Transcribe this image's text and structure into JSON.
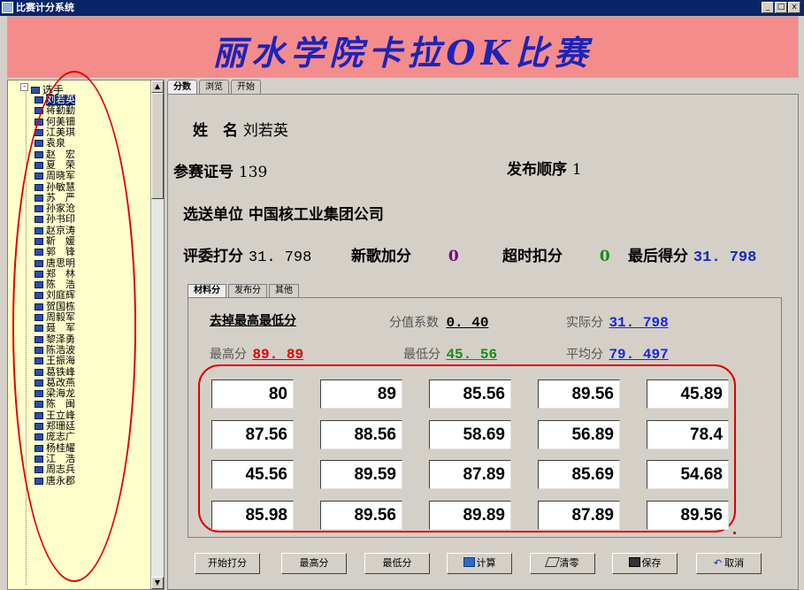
{
  "window": {
    "title": "比赛计分系统"
  },
  "banner": {
    "title": "丽水学院卡拉OK比赛"
  },
  "tree": {
    "root_label": "选手",
    "items": [
      "刘若英",
      "蒋勤勤",
      "何美钿",
      "江美琪",
      "袁泉",
      "赵　宏",
      "夏　荣",
      "周晓军",
      "孙敏慧",
      "苏　严",
      "孙家沧",
      "孙书印",
      "赵京涛",
      "靳　媛",
      "郭　锋",
      "唐思明",
      "郑　林",
      "陈　浩",
      "刘庭辉",
      "贺国栋",
      "周毅军",
      "聂　军",
      "黎泽勇",
      "陈浩波",
      "王振海",
      "葛铁峰",
      "葛改燕",
      "梁海龙",
      "陈　闽",
      "王立峰",
      "郑珊廷",
      "庞志广",
      "杨桂耀",
      "江　浩",
      "周志兵",
      "唐永郡"
    ],
    "selected_index": 0
  },
  "main_tabs": [
    "分数",
    "浏览",
    "开始"
  ],
  "info": {
    "name_label": "姓　名",
    "name_value": "刘若英",
    "id_label": "参赛证号",
    "id_value": "139",
    "order_label": "发布顺序",
    "order_value": "1",
    "unit_label": "选送单位",
    "unit_value": "中国核工业集团公司",
    "judge_label": "评委打分",
    "judge_value": "31. 798",
    "newsong_label": "新歌加分",
    "newsong_value": "0",
    "overtime_label": "超时扣分",
    "overtime_value": "0",
    "final_label": "最后得分",
    "final_value": "31. 798"
  },
  "inner_tabs": [
    "材料分",
    "发布分",
    "其他"
  ],
  "scoring": {
    "drop_label": "去掉最高最低分",
    "coef_label": "分值系数",
    "coef_value": "0. 40",
    "actual_label": "实际分",
    "actual_value": "31. 798",
    "max_label": "最高分",
    "max_value": "89. 89",
    "min_label": "最低分",
    "min_value": "45. 56",
    "avg_label": "平均分",
    "avg_value": "79. 497"
  },
  "scores": [
    [
      "80",
      "89",
      "85.56",
      "89.56",
      "45.89"
    ],
    [
      "87.56",
      "88.56",
      "58.69",
      "56.89",
      "78.4"
    ],
    [
      "45.56",
      "89.59",
      "87.89",
      "85.69",
      "54.68"
    ],
    [
      "85.98",
      "89.56",
      "89.89",
      "87.89",
      "89.56"
    ]
  ],
  "buttons": [
    "开始打分",
    "最高分",
    "最低分",
    "计算",
    "清零",
    "保存",
    "取消"
  ],
  "colors": {
    "accent_blue": "#1c24b8",
    "banner_bg": "#f58c8c",
    "max_red": "#e00000",
    "min_green": "#1a8a1a",
    "purple": "#800080",
    "link_blue": "#1c24d8"
  }
}
